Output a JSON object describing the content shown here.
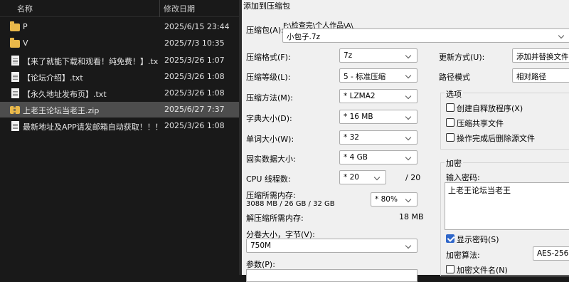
{
  "explorer": {
    "col_name": "名称",
    "col_date": "修改日期",
    "rows": [
      {
        "name": "P",
        "date": "2025/6/15 23:44",
        "icon": "folder-icon"
      },
      {
        "name": "V",
        "date": "2025/7/3 10:35",
        "icon": "folder-icon"
      },
      {
        "name": "【来了就能下载和观看！纯免费！】.txt",
        "date": "2025/3/26 1:07",
        "icon": "text-file-icon"
      },
      {
        "name": "【论坛介绍】.txt",
        "date": "2025/3/26 1:08",
        "icon": "text-file-icon"
      },
      {
        "name": "【永久地址发布页】.txt",
        "date": "2025/3/26 1:08",
        "icon": "text-file-icon"
      },
      {
        "name": "上老王论坛当老王.zip",
        "date": "2025/6/27 7:37",
        "icon": "zip-folder-icon"
      },
      {
        "name": "最新地址及APP请发邮箱自动获取！！！...",
        "date": "2025/3/26 1:08",
        "icon": "text-file-icon"
      }
    ]
  },
  "dialog": {
    "title": "添加到压缩包",
    "archive_label": "压缩包(A):",
    "archive_path": "F:\\检查完\\个人作品\\A\\",
    "archive_name": "小包子.7z",
    "format_label": "压缩格式(F):",
    "format_value": "7z",
    "level_label": "压缩等级(L):",
    "level_value": "5 - 标准压缩",
    "method_label": "压缩方法(M):",
    "method_value": "* LZMA2",
    "dict_label": "字典大小(D):",
    "dict_value": "* 16 MB",
    "word_label": "单词大小(W):",
    "word_value": "* 32",
    "solid_label": "固实数据大小:",
    "solid_value": "* 4 GB",
    "cpu_label": "CPU 线程数:",
    "cpu_value": "* 20",
    "cpu_total": "/ 20",
    "mem_comp_label": "压缩所需内存:",
    "mem_comp_detail": "3088 MB / 26 GB / 32 GB",
    "mem_comp_percent": "* 80%",
    "mem_decomp_label": "解压缩所需内存:",
    "mem_decomp_value": "18 MB",
    "split_label": "分卷大小，字节(V):",
    "split_value": "750M",
    "params_label": "参数(P):",
    "update_label": "更新方式(U):",
    "update_value": "添加并替换文件",
    "path_label": "路径模式",
    "path_value": "相对路径",
    "options_title": "选项",
    "opt_sfx": "创建自释放程序(X)",
    "opt_shared": "压缩共享文件",
    "opt_delete": "操作完成后删除源文件",
    "encrypt_title": "加密",
    "password_label": "输入密码:",
    "password_value": "上老王论坛当老王",
    "show_password": "显示密码(S)",
    "enc_method_label": "加密算法:",
    "enc_method_value": "AES-256",
    "enc_names": "加密文件名(N)"
  }
}
